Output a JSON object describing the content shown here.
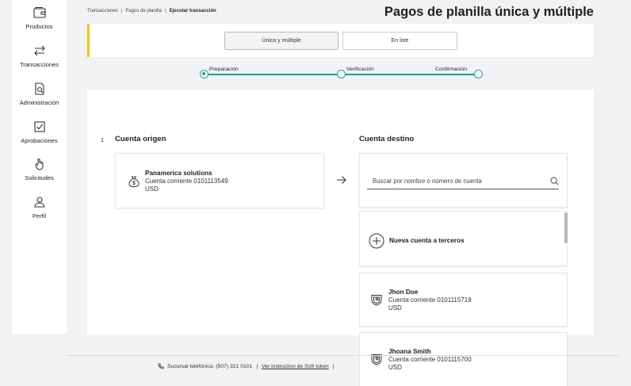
{
  "sidebar": {
    "items": [
      {
        "label": "Productos",
        "icon": "wallet-icon"
      },
      {
        "label": "Transacciones",
        "icon": "transfer-arrows-icon"
      },
      {
        "label": "Administración",
        "icon": "document-search-icon"
      },
      {
        "label": "Aprobaciones",
        "icon": "checkbox-icon"
      },
      {
        "label": "Solicitudes",
        "icon": "hand-pointer-icon"
      },
      {
        "label": "Perfil",
        "icon": "user-icon"
      }
    ]
  },
  "breadcrumb": {
    "items": [
      "Transacciones",
      "Pagos de planilla"
    ],
    "current": "Ejecutar transacción",
    "separator": "|"
  },
  "header": {
    "title": "Pagos de planilla única y múltiple"
  },
  "tabs": [
    {
      "label": "Única y múltiple",
      "active": true
    },
    {
      "label": "En lote",
      "active": false
    }
  ],
  "stepper": {
    "steps": [
      "Preparación",
      "Verificación",
      "Confirmación"
    ],
    "active_color": "#17a78a"
  },
  "origin": {
    "step_number": "1",
    "title": "Cuenta origen",
    "account": {
      "name": "Panamerica solutions",
      "type_number": "Cuenta corriente 0101113549",
      "currency": "USD"
    }
  },
  "destination": {
    "title": "Cuenta destino",
    "search_placeholder": "Buscar por nombre o número de cuenta",
    "new_account_label": "Nueva cuenta a terceros",
    "accounts": [
      {
        "name": "Jhon Doe",
        "type_number": "Cuenta corriente 0101115719",
        "currency": "USD"
      },
      {
        "name": "Jhoana Smith",
        "type_number": "Cuenta corriente 0101115700",
        "currency": "USD"
      }
    ]
  },
  "footer": {
    "phone_text": "Sucursal telefónica: (507) 321 0101",
    "separator": "|",
    "link_text": "Ver instructivo de Soft token"
  },
  "colors": {
    "accent_yellow": "#f5c400",
    "step_green": "#17a78a",
    "background": "#f1f2f4"
  }
}
